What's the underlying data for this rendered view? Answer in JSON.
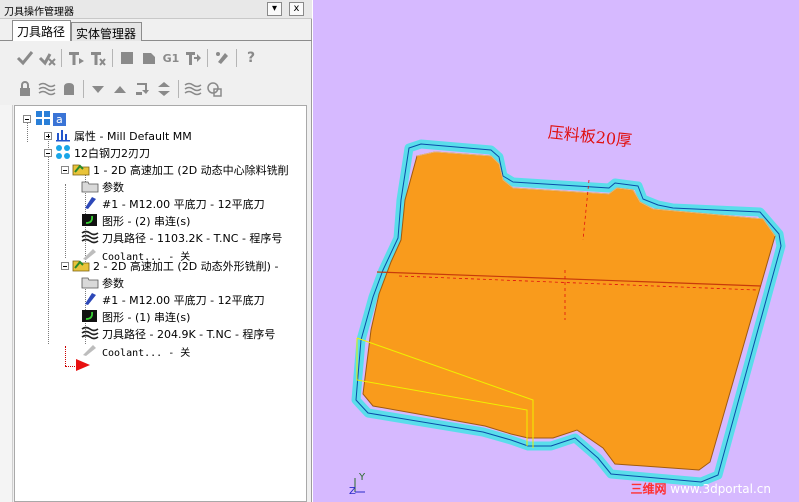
{
  "panel": {
    "title": "刀具操作管理器",
    "pin_glyph": "▾",
    "close_glyph": "x",
    "tabs": [
      {
        "label": "刀具路径",
        "active": true
      },
      {
        "label": "实体管理器",
        "active": false
      }
    ]
  },
  "toolbar1": [
    "select-all-ops-icon",
    "select-invalid-ops-icon",
    "regen-selected-icon",
    "regen-dirty-icon",
    "backplot-icon",
    "verify-icon",
    "g1-post-icon",
    "post-selected-icon",
    "highfeed-icon",
    "help-icon"
  ],
  "toolbar1_g1_label": "G1",
  "toolbar1_help_glyph": "?",
  "toolbar2": [
    "lock-icon",
    "toggle-display-icon",
    "lock-post-icon",
    "move-down-icon",
    "move-up-icon",
    "insert-arrow-icon",
    "scroll-icon",
    "only-display-icon",
    "display-icon"
  ],
  "tree": {
    "root_label": "a",
    "properties": "属性 - Mill Default MM",
    "toolgroup": "12白钢刀2刃刀",
    "op1": {
      "title": "1 - 2D 高速加工 (2D 动态中心除料铣削",
      "params": "参数",
      "tool": "#1 - M12.00 平底刀 - 12平底刀",
      "geometry": "图形 - (2) 串连(s)",
      "toolpath": "刀具路径 - 1103.2K - T.NC - 程序号",
      "coolant": "Coolant... - 关"
    },
    "op2": {
      "title": "2 - 2D 高速加工 (2D 动态外形铣削) -",
      "params": "参数",
      "tool": "#1 - M12.00 平底刀 - 12平底刀",
      "geometry": "图形 - (1) 串连(s)",
      "toolpath": "刀具路径 - 204.9K - T.NC - 程序号",
      "coolant": "Coolant... - 关"
    }
  },
  "viewport": {
    "annotation": "压料板20厚",
    "axis_y": "Y",
    "axis_z": "Z",
    "watermark_cn": "三维网",
    "watermark_url": "www.3dportal.cn"
  },
  "colors": {
    "viewport_bg": "#d6b9ff",
    "part_fill": "#f99b1c",
    "toolpath": "#44e3e8",
    "annotation": "#e01010"
  }
}
